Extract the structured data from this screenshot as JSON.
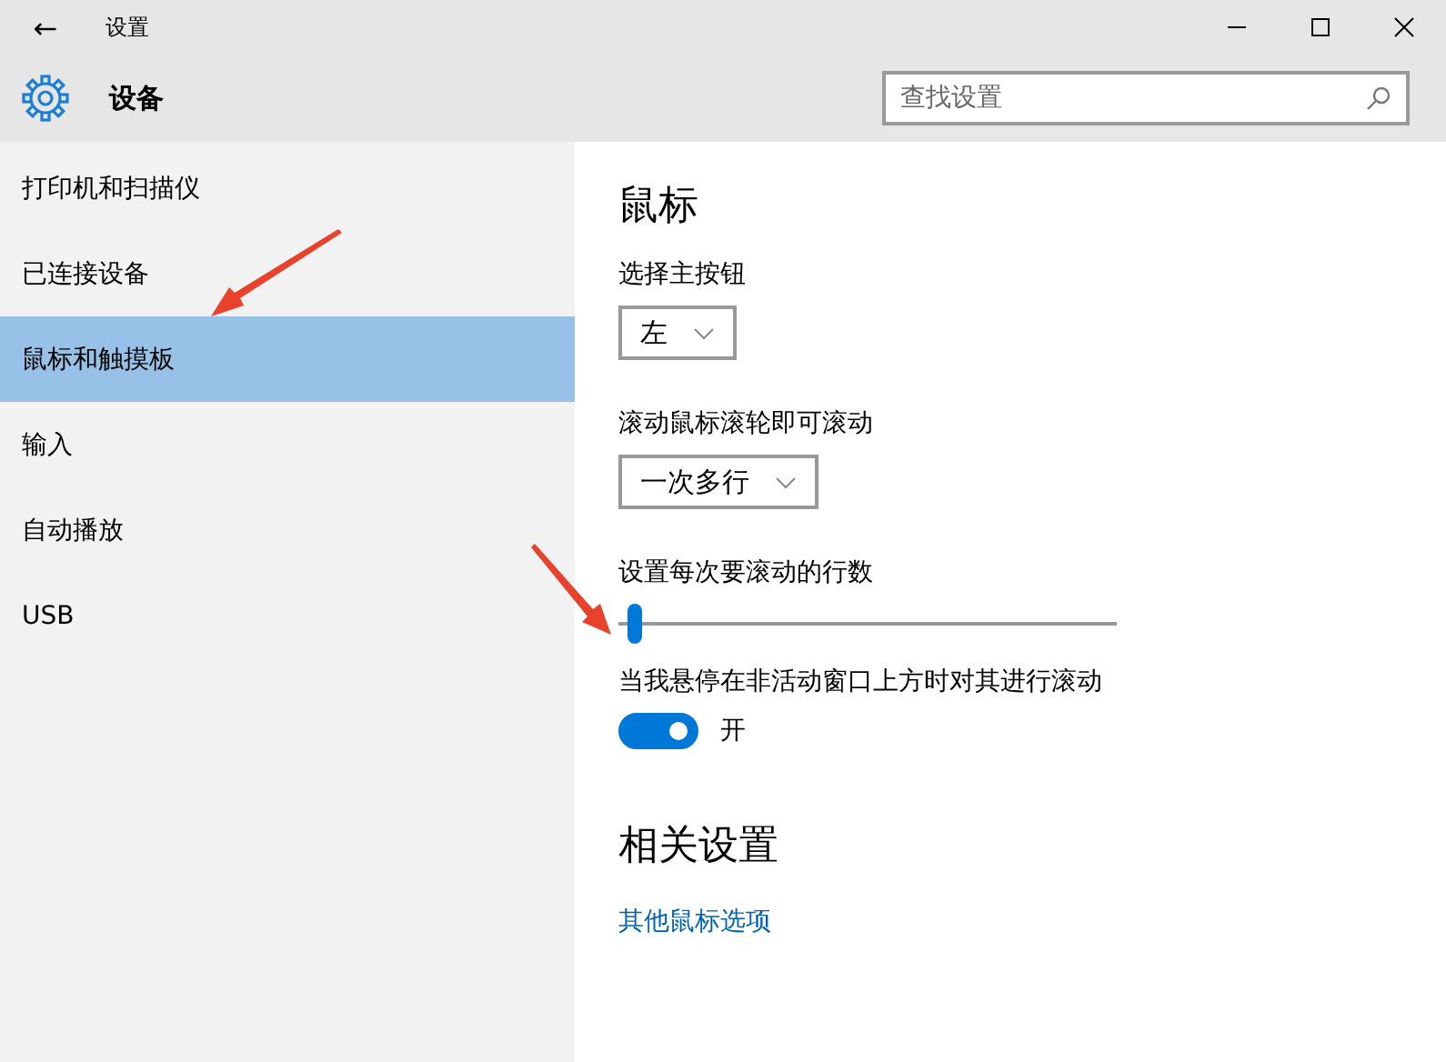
{
  "window": {
    "title": "设置",
    "back": "←"
  },
  "header": {
    "title": "设备",
    "search": {
      "placeholder": "查找设置"
    }
  },
  "sidebar": {
    "items": [
      {
        "label": "打印机和扫描仪",
        "selected": false
      },
      {
        "label": "已连接设备",
        "selected": false
      },
      {
        "label": "鼠标和触摸板",
        "selected": true
      },
      {
        "label": "输入",
        "selected": false
      },
      {
        "label": "自动播放",
        "selected": false
      },
      {
        "label": "USB",
        "selected": false
      }
    ]
  },
  "content": {
    "title": "鼠标",
    "settings": [
      {
        "kind": "dropdown",
        "label": "选择主按钮",
        "value": "左"
      },
      {
        "kind": "dropdown",
        "label": "滚动鼠标滚轮即可滚动",
        "value": "一次多行"
      },
      {
        "kind": "slider",
        "label": "设置每次要滚动的行数",
        "level": 0.02
      },
      {
        "kind": "toggle",
        "label": "当我悬停在非活动窗口上方时对其进行滚动",
        "on": true,
        "state_text": "开"
      }
    ],
    "related": {
      "title": "相关设置",
      "links": [
        "其他鼠标选项"
      ]
    }
  }
}
